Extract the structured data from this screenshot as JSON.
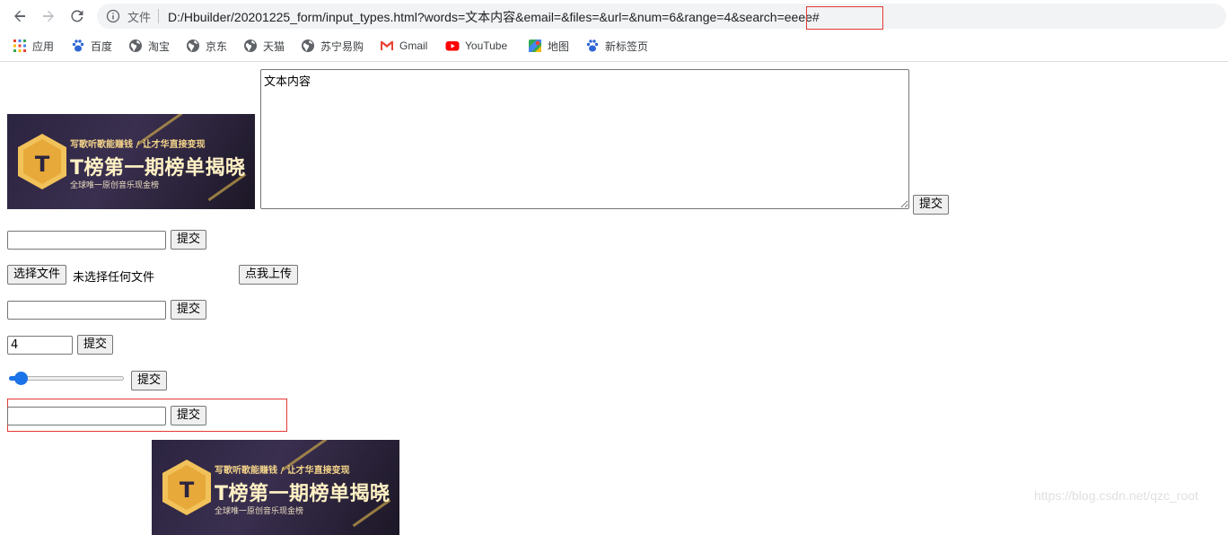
{
  "browser": {
    "omnibox": {
      "scheme_label": "文件",
      "url": "D:/Hbuilder/20201225_form/input_types.html?words=文本内容&email=&files=&url=&num=6&range=4&search=eeee#"
    },
    "bookmarks": [
      {
        "label": "应用",
        "icon": "apps-grid-icon"
      },
      {
        "label": "百度",
        "icon": "baidu-paw-icon"
      },
      {
        "label": "淘宝",
        "icon": "globe-icon"
      },
      {
        "label": "京东",
        "icon": "globe-icon"
      },
      {
        "label": "天猫",
        "icon": "globe-icon"
      },
      {
        "label": "苏宁易购",
        "icon": "globe-icon"
      },
      {
        "label": "Gmail",
        "icon": "gmail-icon"
      },
      {
        "label": "YouTube",
        "icon": "youtube-icon"
      },
      {
        "label": "地图",
        "icon": "maps-icon"
      },
      {
        "label": "新标签页",
        "icon": "baidu-paw-icon"
      }
    ]
  },
  "page": {
    "banner": {
      "tagline": "写歌听歌能赚钱 / 让才华直接变现",
      "headline": "T榜第一期榜单揭晓",
      "subline": "全球唯一原创音乐现金榜"
    },
    "words_form": {
      "textarea_value": "文本内容",
      "submit_label": "提交"
    },
    "email_form": {
      "value": "",
      "submit_label": "提交"
    },
    "file_form": {
      "choose_label": "选择文件",
      "status": "未选择任何文件",
      "upload_label": "点我上传"
    },
    "url_form": {
      "value": "",
      "submit_label": "提交"
    },
    "number_form": {
      "value": "4",
      "submit_label": "提交"
    },
    "range_form": {
      "value": 4,
      "min": 0,
      "max": 100,
      "submit_label": "提交"
    },
    "search_form": {
      "value": "",
      "submit_label": "提交"
    }
  },
  "watermark": "https://blog.csdn.net/qzc_root",
  "colors": {
    "highlight": "#e53935",
    "accent": "#1a73e8"
  }
}
